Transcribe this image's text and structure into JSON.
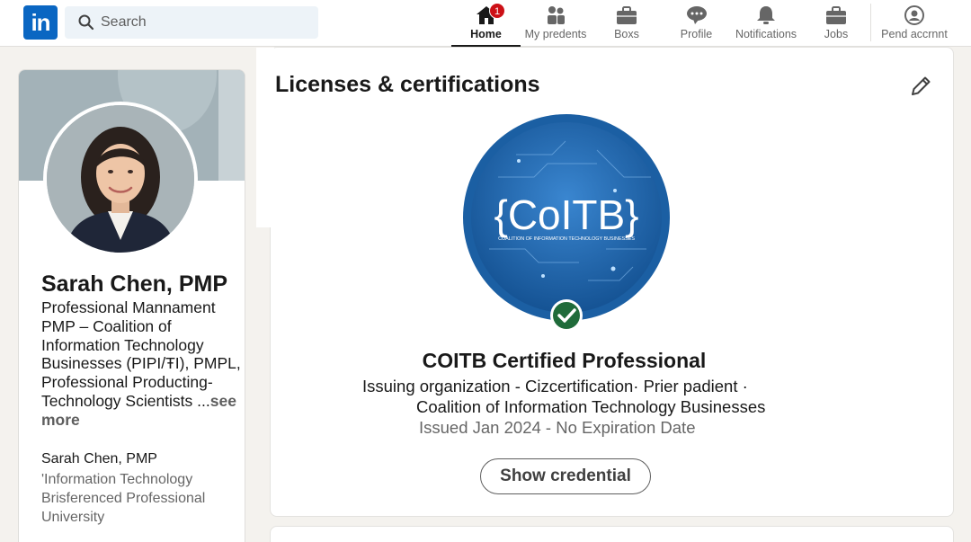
{
  "brand": {
    "logo_text": "in",
    "accent": "#0a66c2"
  },
  "search": {
    "placeholder": "Search",
    "icon": "search-icon"
  },
  "nav": {
    "items": [
      {
        "label": "Home",
        "icon": "home-icon",
        "active": true,
        "badge": "1"
      },
      {
        "label": "My predents",
        "icon": "people-icon"
      },
      {
        "label": "Boxs",
        "icon": "briefcase-icon"
      },
      {
        "label": "Profile",
        "icon": "chat-icon"
      },
      {
        "label": "Notifications",
        "icon": "bell-icon"
      },
      {
        "label": "Jobs",
        "icon": "briefcase-icon"
      },
      {
        "label": "Pend accrnnt",
        "icon": "account-icon"
      }
    ]
  },
  "profile": {
    "name": "Sarah Chen, PMP",
    "headline": "Professional Mannament PMP – Coalition of Information Technology Businesses (PIPI/ŦI), PMPL, Professional Producting- Technology Scientists ...",
    "see_more": "see more",
    "sub_name": "Sarah Chen, PMP",
    "sub_lines": [
      "'Information Technology",
      "Brisferenced Professional",
      "University"
    ]
  },
  "certifications": {
    "section_title": "Licenses & certifications",
    "edit_icon": "pencil-icon",
    "badge": {
      "brand_text": "{CoITB}",
      "caption": "COALITION OF INFORMATION TECHNOLOGY BUSINESSES",
      "ring_color": "#1b5fa3",
      "verified_color": "#1f6b3a"
    },
    "title": "COITB Certified Professional",
    "issuer_line1": "Issuing organization - Cizcertification· Prier padient ·",
    "issuer_line2": "Coalition of Information Technology Businesses",
    "issued": "Issued Jan 2024 - No Expiration Date",
    "button_label": "Show credential"
  }
}
